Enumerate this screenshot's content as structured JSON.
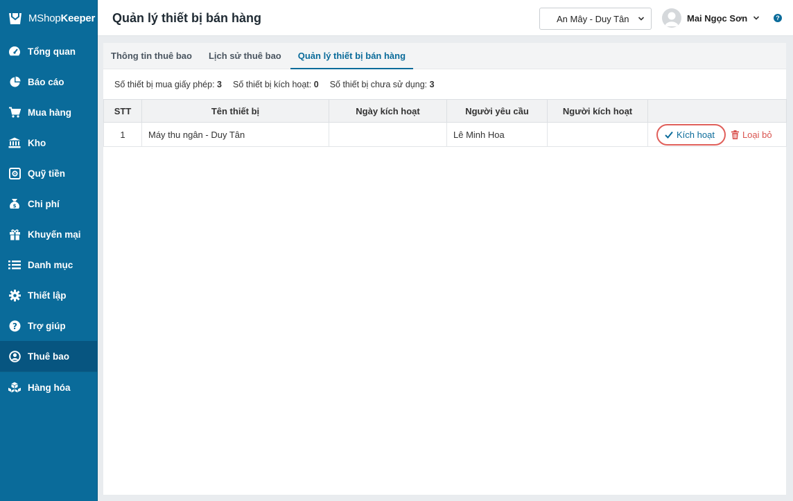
{
  "logo": {
    "text_pre": "MShop",
    "text_bold": "Keeper"
  },
  "sidebar": {
    "items": [
      {
        "label": "Tổng quan",
        "icon": "dashboard-icon"
      },
      {
        "label": "Báo cáo",
        "icon": "pie-chart-icon"
      },
      {
        "label": "Mua hàng",
        "icon": "cart-icon"
      },
      {
        "label": "Kho",
        "icon": "bank-icon"
      },
      {
        "label": "Quỹ tiền",
        "icon": "safe-icon"
      },
      {
        "label": "Chi phí",
        "icon": "money-bag-icon"
      },
      {
        "label": "Khuyến mại",
        "icon": "gift-icon"
      },
      {
        "label": "Danh mục",
        "icon": "list-icon"
      },
      {
        "label": "Thiết lập",
        "icon": "gear-icon"
      },
      {
        "label": "Trợ giúp",
        "icon": "help-circle-icon"
      },
      {
        "label": "Thuê bao",
        "icon": "user-circle-icon",
        "active": true
      },
      {
        "label": "Hàng hóa",
        "icon": "cubes-icon"
      }
    ]
  },
  "header": {
    "title": "Quản lý thiết bị bán hàng",
    "store": "An Mây - Duy Tân",
    "user_name": "Mai Ngọc Sơn",
    "help": "?"
  },
  "tabs": [
    {
      "label": "Thông tin thuê bao",
      "active": false
    },
    {
      "label": "Lịch sử thuê bao",
      "active": false
    },
    {
      "label": "Quản lý thiết bị bán hàng",
      "active": true
    }
  ],
  "stats": {
    "licensed_label": "Số thiết bị mua giấy phép:",
    "licensed_value": "3",
    "activated_label": "Số thiết bị kích hoạt:",
    "activated_value": "0",
    "unused_label": "Số thiết bị chưa sử dụng:",
    "unused_value": "3"
  },
  "table": {
    "headers": [
      "STT",
      "Tên thiết bị",
      "Ngày kích hoạt",
      "Người yêu cầu",
      "Người kích hoạt",
      ""
    ],
    "rows": [
      {
        "stt": "1",
        "device": "Máy thu ngân - Duy Tân",
        "activated_date": "",
        "requester": "Lê Minh Hoa",
        "activator": ""
      }
    ],
    "activate_label": "Kích hoạt",
    "remove_label": "Loại bỏ"
  },
  "colors": {
    "sidebar": "#0a6b9a",
    "accent": "#0a6b9a",
    "danger": "#d9534f"
  }
}
